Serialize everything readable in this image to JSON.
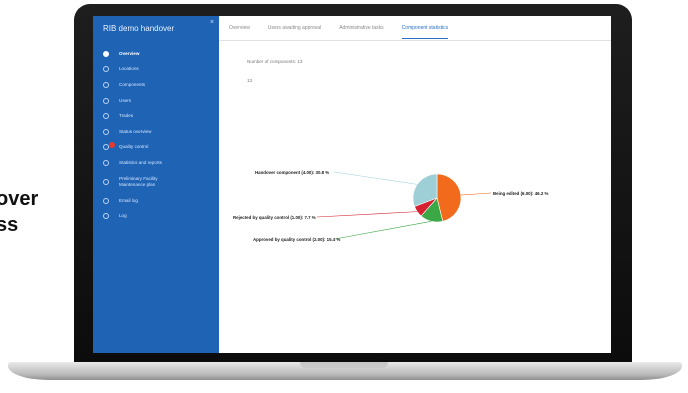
{
  "side_text": [
    "over",
    "ss"
  ],
  "app": {
    "title": "RIB demo handover",
    "close_glyph": "×"
  },
  "sidebar": {
    "items": [
      {
        "label": "Overview",
        "icon": "home-icon",
        "active": true
      },
      {
        "label": "Locations",
        "icon": "location-pin-icon"
      },
      {
        "label": "Components",
        "icon": "component-icon"
      },
      {
        "label": "Users",
        "icon": "users-icon"
      },
      {
        "label": "Trades",
        "icon": "trades-icon"
      },
      {
        "label": "Status overview",
        "icon": "status-icon"
      },
      {
        "label": "Quality control",
        "icon": "quality-control-icon",
        "badge": true
      },
      {
        "label": "Statistics and reports",
        "icon": "statistics-icon"
      },
      {
        "label": "Preliminary Facility Maintenance plan",
        "icon": "maintenance-icon"
      },
      {
        "label": "Email log",
        "icon": "email-icon"
      },
      {
        "label": "Log",
        "icon": "log-icon"
      }
    ]
  },
  "tabs": [
    {
      "label": "Overview"
    },
    {
      "label": "Users awaiting approval"
    },
    {
      "label": "Administrative tasks"
    },
    {
      "label": "Component statistics",
      "active": true
    }
  ],
  "main": {
    "count_label": "Number of components: 13",
    "count_sub": "13"
  },
  "chart_data": {
    "type": "pie",
    "slices": [
      {
        "label": "Being edited (6.00): 46.2 %",
        "value": 46.2,
        "color": "#f26a1b"
      },
      {
        "label": "Approved by quality control (2.00): 15.4 %",
        "value": 15.4,
        "color": "#3aa845"
      },
      {
        "label": "Rejected by quality control (1.00): 7.7 %",
        "value": 7.7,
        "color": "#d4202f"
      },
      {
        "label": "Handover component (4.00): 30.8 %",
        "value": 30.8,
        "color": "#9fcfd6"
      }
    ]
  }
}
